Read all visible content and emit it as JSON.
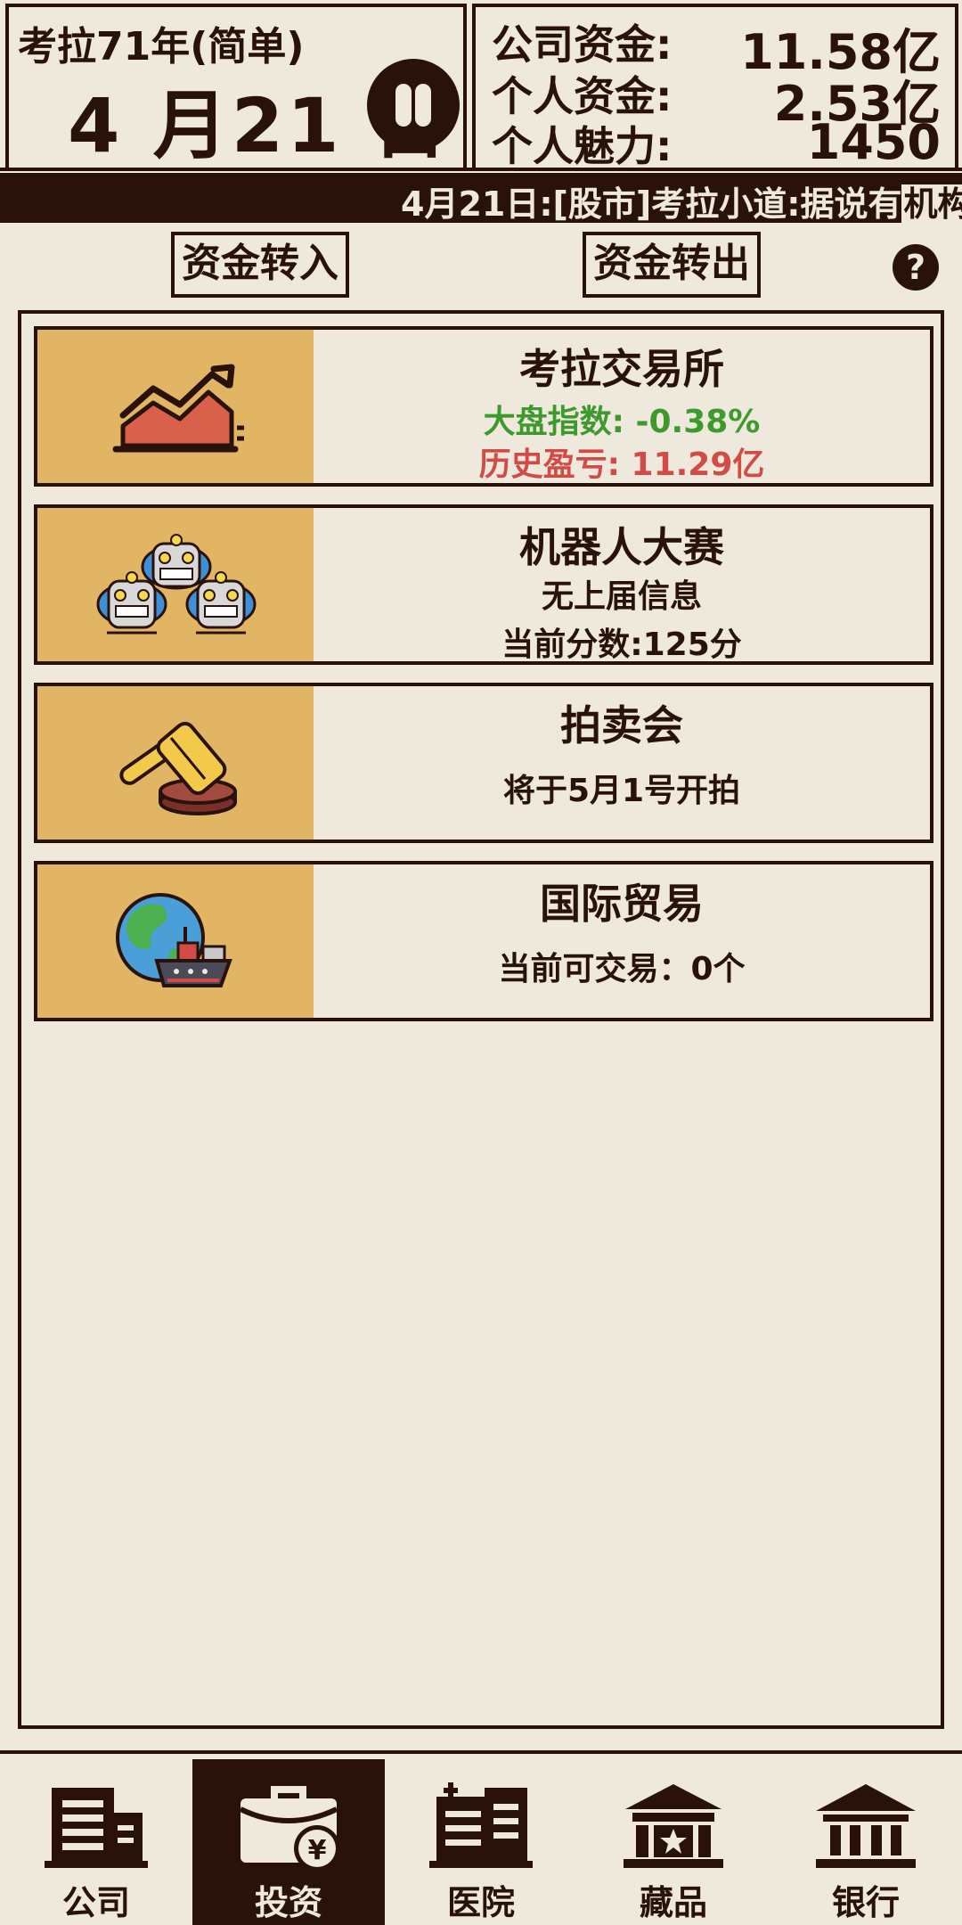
{
  "header": {
    "year_label": "考拉71年(简单)",
    "date_label": "4 月21 日",
    "stats": [
      {
        "label": "公司资金:",
        "value": "11.58亿"
      },
      {
        "label": "个人资金:",
        "value": "2.53亿"
      },
      {
        "label": "个人魅力:",
        "value": "1450"
      }
    ]
  },
  "ticker": {
    "text": "4月21日:[股市]考拉小道:据说有",
    "highlight": "机构"
  },
  "actions": {
    "transfer_in": "资金转入",
    "transfer_out": "资金转出",
    "help": "?"
  },
  "cards": [
    {
      "title": "考拉交易所",
      "line1": "大盘指数: -0.38%",
      "line2": "历史盈亏: 11.29亿",
      "icon": "stock-chart-icon"
    },
    {
      "title": "机器人大赛",
      "line1": "无上届信息",
      "line2": "当前分数:125分",
      "icon": "robots-icon"
    },
    {
      "title": "拍卖会",
      "line1": "将于5月1号开拍",
      "icon": "gavel-icon"
    },
    {
      "title": "国际贸易",
      "line1": "当前可交易：0个",
      "icon": "globe-ship-icon"
    }
  ],
  "colors": {
    "dark": "#2a120c",
    "background": "#efe8dc",
    "icon_bg": "#e2b565",
    "positive_green": "#3f9a2e",
    "negative_red": "#d14b47"
  },
  "nav": [
    {
      "label": "公司",
      "icon": "office-building-icon",
      "active": false
    },
    {
      "label": "投资",
      "icon": "briefcase-yen-icon",
      "active": true
    },
    {
      "label": "医院",
      "icon": "hospital-icon",
      "active": false
    },
    {
      "label": "藏品",
      "icon": "museum-star-icon",
      "active": false
    },
    {
      "label": "银行",
      "icon": "bank-icon",
      "active": false
    }
  ]
}
